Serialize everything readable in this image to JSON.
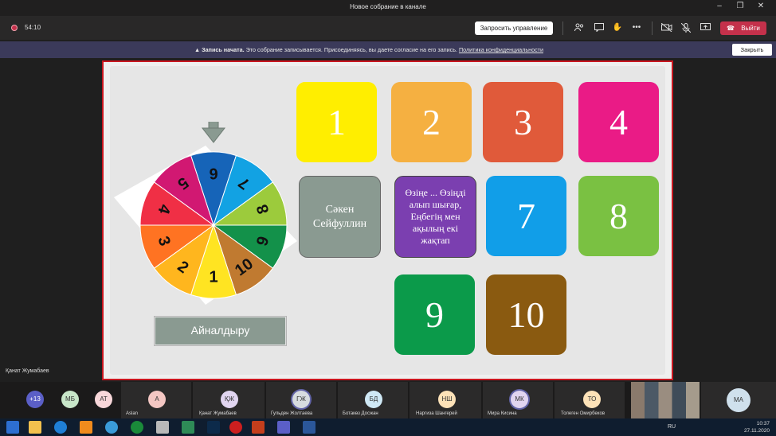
{
  "window": {
    "title": "Новое собрание в канале"
  },
  "meeting": {
    "timer": "54:10",
    "request_control": "Запросить управление",
    "leave": "Выйти"
  },
  "notification": {
    "bold": "Запись начата.",
    "text": " Это собрание записывается. Присоединяясь, вы даете согласие на его запись. ",
    "link": "Политика конфиденциальности",
    "close": "Закрыть"
  },
  "slide": {
    "tiles": [
      {
        "label": "1",
        "color": "#ffee00"
      },
      {
        "label": "2",
        "color": "#f5b041"
      },
      {
        "label": "3",
        "color": "#e05a3a"
      },
      {
        "label": "4",
        "color": "#ea1b86"
      },
      {
        "label": "Сәкен Сейфуллин",
        "color": "#8a9a91"
      },
      {
        "label": "Өзіңе ... Өзіңді алып шығар, Еңбегің мен ақылың екі жақтап",
        "color": "#7b3fb0"
      },
      {
        "label": "7",
        "color": "#119ee8"
      },
      {
        "label": "8",
        "color": "#7ac142"
      },
      {
        "label": "9",
        "color": "#0b9a4a"
      },
      {
        "label": "10",
        "color": "#8a5a10"
      }
    ],
    "wheel_numbers": [
      "1",
      "2",
      "3",
      "4",
      "5",
      "6",
      "7",
      "8",
      "9",
      "10"
    ],
    "spin_button": "Айналдыру"
  },
  "presenter_name": "Қанат Жумабаев",
  "participants": [
    {
      "initials": "+13",
      "name": "",
      "color": "#5b5fc7"
    },
    {
      "initials": "МБ",
      "name": "",
      "color": "#c8e6c9"
    },
    {
      "initials": "АТ",
      "name": "",
      "color": "#f8d7da"
    },
    {
      "initials": "А",
      "name": "Aslan",
      "color": "#f4c7c3"
    },
    {
      "initials": "ҚЖ",
      "name": "Қанат Жумабаев",
      "color": "#e1d5f0"
    },
    {
      "initials": "ГЖ",
      "name": "Гульден Жолтаева",
      "color": "#d7dce0"
    },
    {
      "initials": "БД",
      "name": "Ботакөз Досжан",
      "color": "#cfe8f5"
    },
    {
      "initials": "НШ",
      "name": "Наргиза Шангерей",
      "color": "#fde2b8"
    },
    {
      "initials": "МК",
      "name": "Мира Кисина",
      "color": "#e1d5f0"
    },
    {
      "initials": "ТО",
      "name": "Толеген Омирбеков",
      "color": "#fde2b8"
    },
    {
      "initials": "МА",
      "name": "",
      "color": "#cfe0ec"
    }
  ],
  "taskbar": {
    "lang": "RU",
    "time": "10:37",
    "date": "27.11.2020"
  }
}
